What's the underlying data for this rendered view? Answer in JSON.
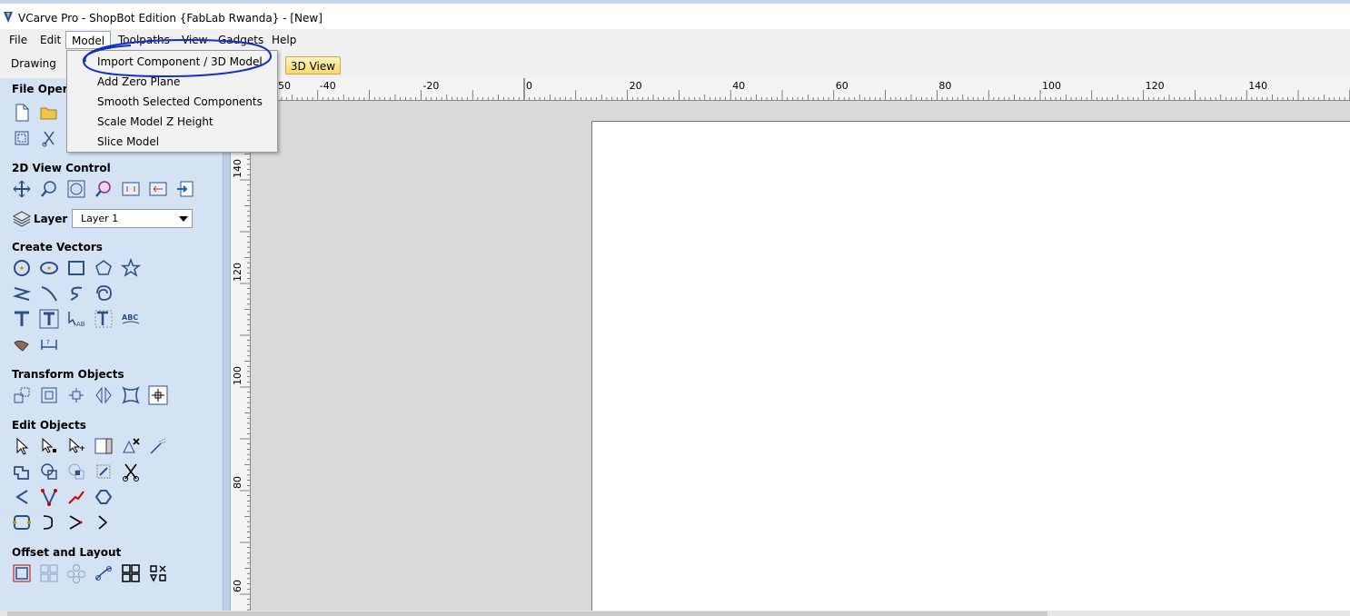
{
  "window": {
    "title": "VCarve Pro - ShopBot Edition {FabLab Rwanda} - [New]"
  },
  "menubar": {
    "items": [
      "File",
      "Edit",
      "Model",
      "Toolpaths",
      "View",
      "Gadgets",
      "Help"
    ],
    "active": "Model"
  },
  "model_menu": {
    "items": [
      "Import Component / 3D Model",
      "Add Zero Plane",
      "Smooth Selected Components",
      "Scale Model Z Height",
      "Slice Model"
    ]
  },
  "tabs": {
    "drawing": "Drawing",
    "view3d": "3D View"
  },
  "sidebar": {
    "file_operations": "File Operat",
    "view_control": "2D View Control",
    "layer_label": "Layer",
    "layer_value": "Layer 1",
    "create_vectors": "Create Vectors",
    "transform_objects": "Transform Objects",
    "edit_objects": "Edit Objects",
    "offset_layout": "Offset and Layout"
  },
  "ruler": {
    "h_labels": [
      "50",
      "-40",
      "-20",
      "0",
      "20",
      "40",
      "60",
      "80",
      "100",
      "120",
      "140"
    ],
    "v_labels": [
      "140",
      "120",
      "100",
      "80",
      "60"
    ]
  },
  "colors": {
    "sidebar": "#d4e3f3",
    "accent": "#1f3a9a",
    "annotation": "#1030c8"
  }
}
